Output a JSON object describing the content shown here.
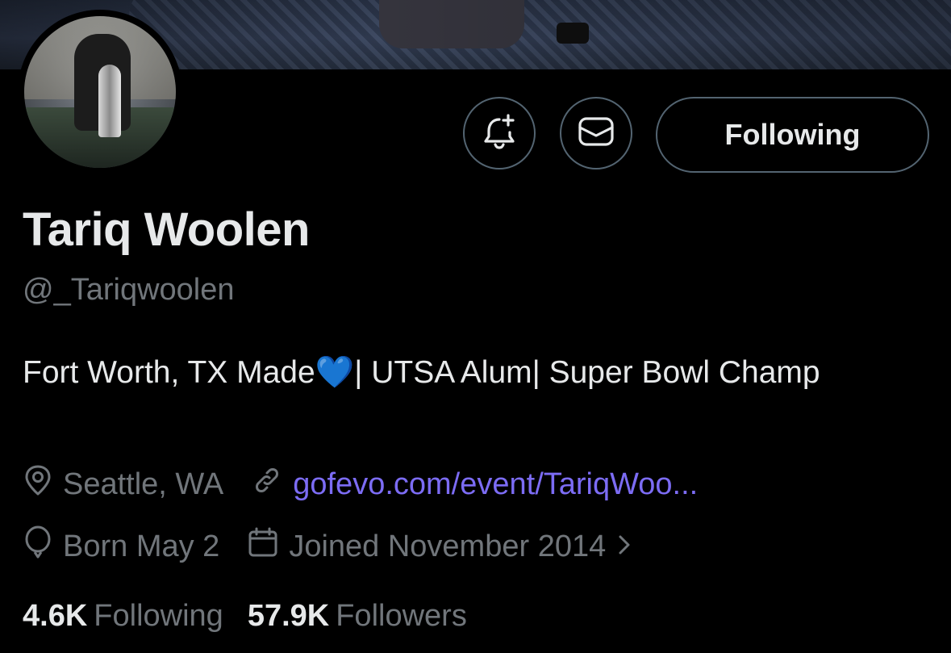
{
  "profile": {
    "name": "Tariq Woolen",
    "handle": "@_Tariqwoolen",
    "bio_text": "Fort Worth, TX Made",
    "bio_emoji": "💙",
    "bio_rest": "| UTSA Alum| Super Bowl Champ",
    "location": "Seattle, WA",
    "website": "gofevo.com/event/TariqWoo...",
    "birthday": "Born May 2",
    "joined": "Joined November 2014"
  },
  "actions": {
    "following_label": "Following",
    "notify_icon": "bell-plus-icon",
    "message_icon": "envelope-icon"
  },
  "stats": {
    "following_count": "4.6K",
    "following_label": "Following",
    "followers_count": "57.9K",
    "followers_label": "Followers"
  },
  "colors": {
    "background": "#000000",
    "text_primary": "#e7e9ea",
    "text_secondary": "#71767b",
    "link": "#7c6cf4",
    "border": "#536471",
    "heart": "#1d6fe8"
  }
}
